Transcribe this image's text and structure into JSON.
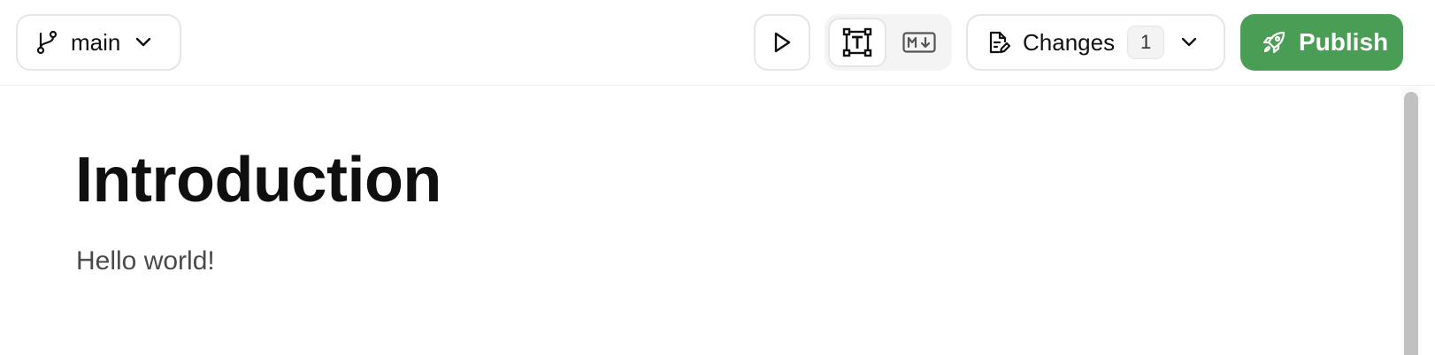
{
  "toolbar": {
    "branch": {
      "label": "main",
      "icon": "git-branch-icon"
    },
    "play": {
      "icon": "play-icon"
    },
    "view_modes": [
      {
        "icon": "text-frame-icon",
        "selected": true
      },
      {
        "icon": "markdown-icon",
        "selected": false
      }
    ],
    "changes": {
      "label": "Changes",
      "count": "1",
      "icon": "file-edit-icon"
    },
    "publish": {
      "label": "Publish",
      "icon": "rocket-icon"
    }
  },
  "document": {
    "title": "Introduction",
    "body": "Hello world!"
  },
  "colors": {
    "publish_bg": "#4a9d54",
    "border": "#e6e6e6",
    "title_text": "#0f0f0f",
    "body_text": "#4a4a4a"
  }
}
